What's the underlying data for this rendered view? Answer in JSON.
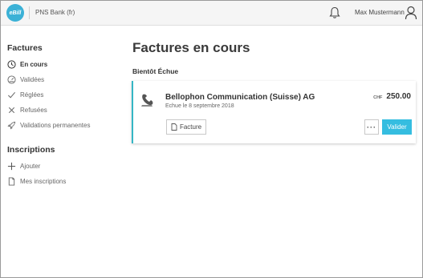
{
  "header": {
    "logo_text": "eBill",
    "bank_name": "PNS Bank (fr)",
    "user_name": "Max Mustermann",
    "accent_color": "#3bb1d6"
  },
  "sidebar": {
    "factures_heading": "Factures",
    "factures_items": [
      {
        "label": "En cours",
        "icon": "clock-icon",
        "active": true
      },
      {
        "label": "Validées",
        "icon": "gauge-icon",
        "active": false
      },
      {
        "label": "Réglées",
        "icon": "check-icon",
        "active": false
      },
      {
        "label": "Refusées",
        "icon": "x-icon",
        "active": false
      },
      {
        "label": "Validations permanentes",
        "icon": "rocket-icon",
        "active": false
      }
    ],
    "inscriptions_heading": "Inscriptions",
    "inscriptions_items": [
      {
        "label": "Ajouter",
        "icon": "plus-icon"
      },
      {
        "label": "Mes inscriptions",
        "icon": "document-icon"
      }
    ]
  },
  "main": {
    "title": "Factures en cours",
    "section_heading": "Bientôt Échue",
    "card": {
      "issuer": "Bellophon Communication (Suisse) AG",
      "due_text": "Echue le 8 septembre 2018",
      "currency": "CHF",
      "amount": "250.00",
      "facture_label": "Facture",
      "more_label": "···",
      "valider_label": "Valider",
      "accent_color": "#35b6c5",
      "button_color": "#35bde0"
    }
  }
}
